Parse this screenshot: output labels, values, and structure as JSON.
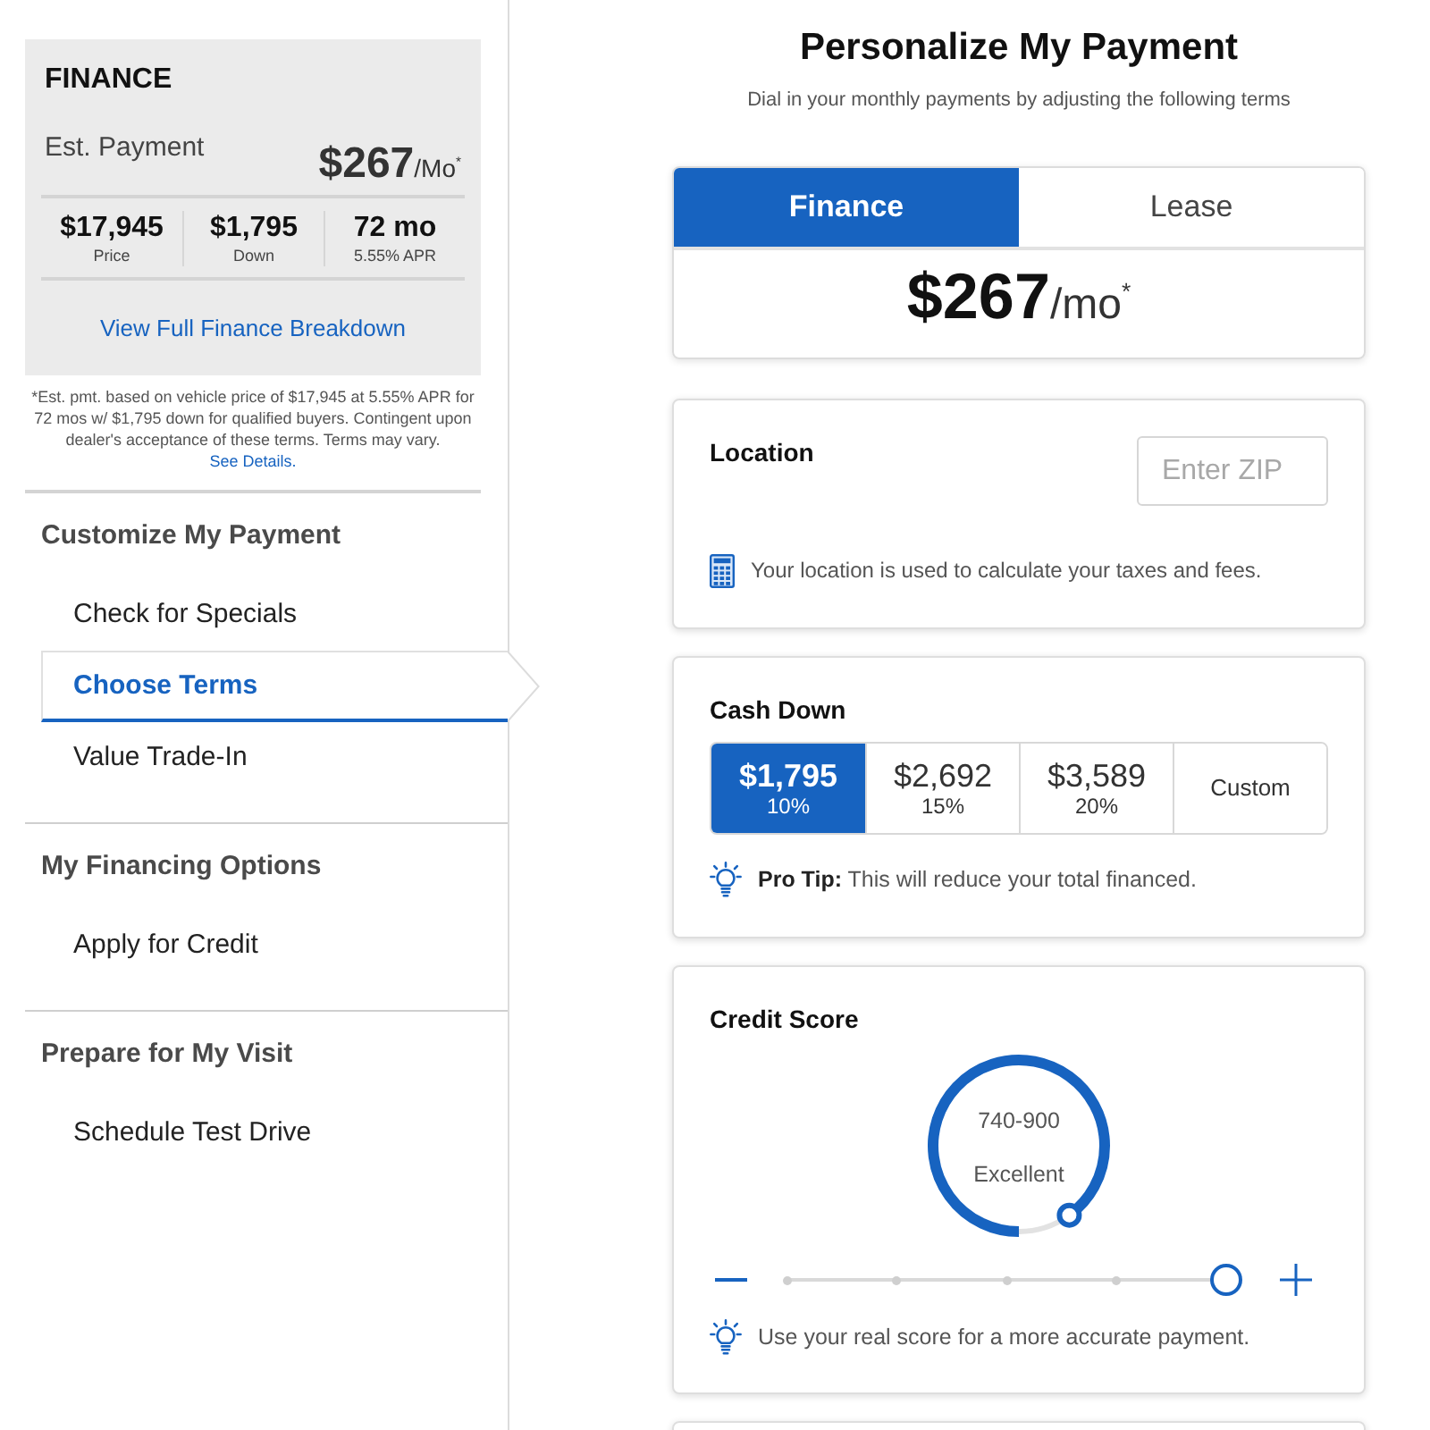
{
  "summary": {
    "title": "FINANCE",
    "payment_label": "Est. Payment",
    "payment_amount": "$267",
    "payment_unit": "/Mo$^{*}$",
    "stats": [
      {
        "value": "$17,945",
        "label": "Price"
      },
      {
        "value": "$1,795",
        "label": "Down"
      },
      {
        "value": "72 mo",
        "label": "5.55% APR"
      }
    ],
    "link": "View Full Finance Breakdown"
  },
  "disclaimer": {
    "text": "*Est. pmt. based on vehicle price of $17,945 at 5.55% APR for 72 mos w/ $1,795 down for qualified buyers. Contingent upon dealer's acceptance of these terms. Terms may vary.",
    "link": "See Details."
  },
  "sidebar": {
    "sections": [
      {
        "heading": "Customize My Payment",
        "items": [
          {
            "label": "Check for Specials",
            "selected": false
          },
          {
            "label": "Choose Terms",
            "selected": true
          },
          {
            "label": "Value Trade-In",
            "selected": false
          }
        ]
      },
      {
        "heading": "My Financing Options",
        "items": [
          {
            "label": "Apply for Credit",
            "selected": false
          }
        ]
      },
      {
        "heading": "Prepare for My Visit",
        "items": [
          {
            "label": "Schedule Test Drive",
            "selected": false
          }
        ]
      }
    ]
  },
  "main": {
    "title": "Personalize My Payment",
    "subtitle": "Dial in your monthly payments by adjusting the following terms",
    "tabs": [
      {
        "label": "Finance",
        "selected": true
      },
      {
        "label": "Lease",
        "selected": false
      }
    ],
    "payment": {
      "amount": "$267",
      "unit": "/mo$^{*}$"
    }
  },
  "location": {
    "title": "Location",
    "zip": {
      "placeholder": "Enter ZIP"
    },
    "note": "Your location is used to calculate your taxes and fees."
  },
  "cash_down": {
    "title": "Cash Down",
    "options": [
      {
        "kind": "amount",
        "amount": "$1,795",
        "percent": "10%",
        "selected": true
      },
      {
        "kind": "amount",
        "amount": "$2,692",
        "percent": "15%",
        "selected": false
      },
      {
        "kind": "amount",
        "amount": "$3,589",
        "percent": "20%",
        "selected": false
      },
      {
        "kind": "custom",
        "label": "Custom",
        "selected": false
      }
    ],
    "tip": "**Pro Tip:** This will reduce your total financed."
  },
  "credit_score": {
    "title": "Credit Score",
    "dial": {
      "range": "740-900",
      "rating": "Excellent",
      "level": 0.9
    },
    "slider": {
      "level": 1
    },
    "tip": "Use your real score for a more accurate payment."
  }
}
